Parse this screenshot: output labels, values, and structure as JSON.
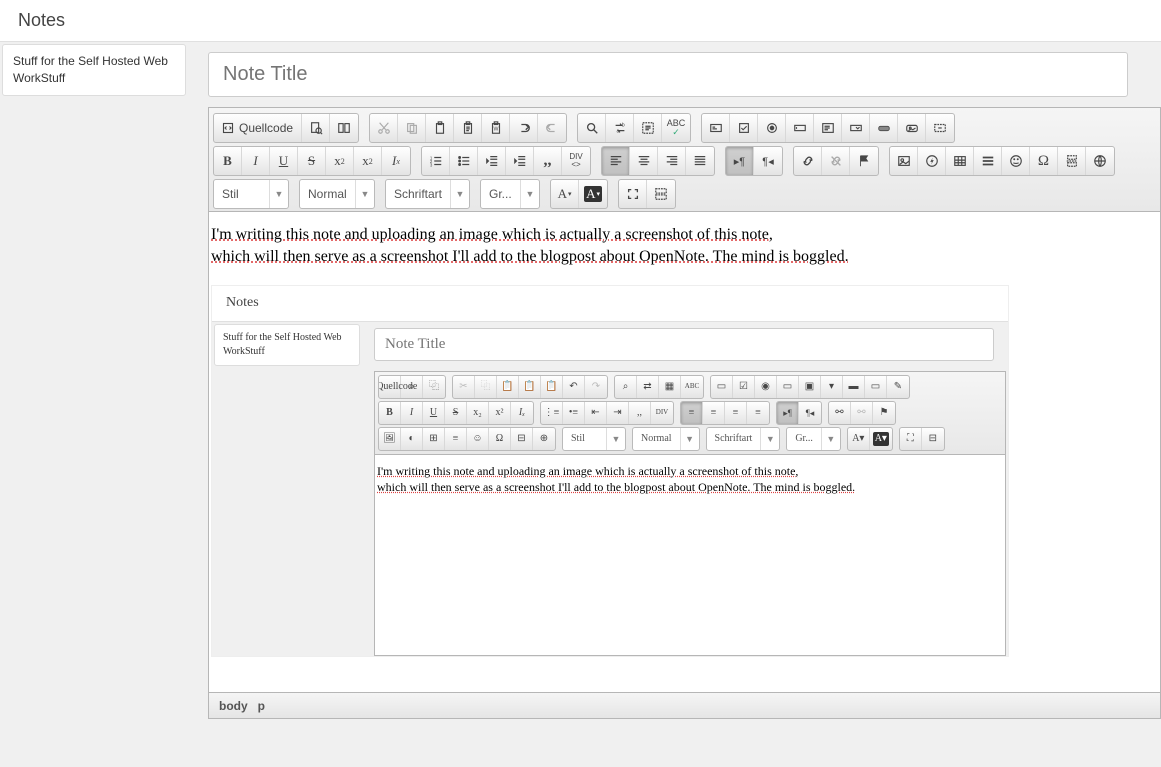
{
  "header": {
    "title": "Notes"
  },
  "sidebar": {
    "items": [
      {
        "line1": "Stuff for the Self Hosted Web",
        "line2": "WorkStuff"
      }
    ]
  },
  "note": {
    "title_placeholder": "Note Title",
    "content_line1_a": "I'm writing this note and uploading an image which is actually a screenshot of this note,",
    "content_line2_a": "which will then serve as a screenshot I'll add to the blogpost about OpenNote. The mind is boggled."
  },
  "toolbar": {
    "source_label": "Quellcode",
    "style_label": "Stil",
    "format_label": "Normal",
    "font_label": "Schriftart",
    "size_label": "Gr...",
    "fontcolor": "A",
    "bgcolor": "A",
    "div_top": "DIV",
    "div_bot": "<>"
  },
  "status": {
    "path1": "body",
    "path2": "p"
  }
}
